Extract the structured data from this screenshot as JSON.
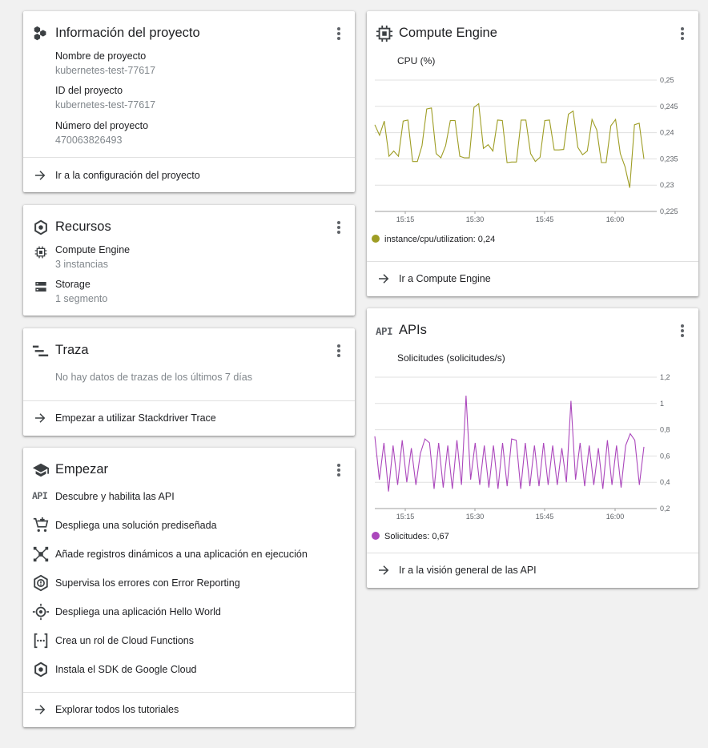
{
  "project": {
    "title": "Información del proyecto",
    "name_label": "Nombre de proyecto",
    "name_value": "kubernetes-test-77617",
    "id_label": "ID del proyecto",
    "id_value": "kubernetes-test-77617",
    "number_label": "Número del proyecto",
    "number_value": "470063826493",
    "link": "Ir a la configuración del proyecto"
  },
  "resources": {
    "title": "Recursos",
    "items": [
      {
        "label": "Compute Engine",
        "sub": "3 instancias",
        "icon": "chip-icon"
      },
      {
        "label": "Storage",
        "sub": "1 segmento",
        "icon": "storage-icon"
      }
    ]
  },
  "trace": {
    "title": "Traza",
    "empty": "No hay datos de trazas de los últimos 7 días",
    "link": "Empezar a utilizar Stackdriver Trace"
  },
  "getting_started": {
    "title": "Empezar",
    "api_glyph": "API",
    "items": [
      {
        "label": "Descubre y habilita las API",
        "icon": "api-icon"
      },
      {
        "label": "Despliega una solución prediseñada",
        "icon": "cart-icon"
      },
      {
        "label": "Añade registros dinámicos a una aplicación en ejecución",
        "icon": "debug-icon"
      },
      {
        "label": "Supervisa los errores con Error Reporting",
        "icon": "error-reporting-icon"
      },
      {
        "label": "Despliega una aplicación Hello World",
        "icon": "target-icon"
      },
      {
        "label": "Crea un rol de Cloud Functions",
        "icon": "functions-icon"
      },
      {
        "label": "Instala el SDK de Google Cloud",
        "icon": "sdk-icon"
      }
    ],
    "link": "Explorar todos los tutoriales"
  },
  "compute": {
    "title": "Compute Engine",
    "chart_title": "CPU (%)",
    "legend_label": "instance/cpu/utilization:",
    "legend_value": "0,24",
    "link": "Ir a Compute Engine",
    "color": "#9e9d24"
  },
  "apis": {
    "title": "APIs",
    "glyph": "API",
    "chart_title": "Solicitudes (solicitudes/s)",
    "legend_label": "Solicitudes:",
    "legend_value": "0,67",
    "link": "Ir a la visión general de las API",
    "color": "#ab47bc"
  },
  "chart_data": [
    {
      "type": "line",
      "title": "CPU (%)",
      "x_ticks": [
        "15:15",
        "15:30",
        "15:45",
        "16:00"
      ],
      "y_ticks": [
        "0,225",
        "0,23",
        "0,235",
        "0,24",
        "0,245",
        "0,25"
      ],
      "ylim": [
        0.225,
        0.25
      ],
      "grid": true,
      "series": [
        {
          "name": "instance/cpu/utilization",
          "color": "#9e9d24",
          "values": [
            0.2415,
            0.2395,
            0.2422,
            0.2355,
            0.2365,
            0.2355,
            0.2422,
            0.2424,
            0.2345,
            0.2345,
            0.2375,
            0.2445,
            0.2447,
            0.236,
            0.2352,
            0.2375,
            0.2423,
            0.2423,
            0.2355,
            0.2352,
            0.2352,
            0.2448,
            0.2455,
            0.237,
            0.2377,
            0.2365,
            0.2424,
            0.2423,
            0.2343,
            0.2344,
            0.2344,
            0.2424,
            0.2424,
            0.236,
            0.2345,
            0.2353,
            0.2423,
            0.2424,
            0.2367,
            0.2367,
            0.2368,
            0.2435,
            0.2441,
            0.2372,
            0.2358,
            0.2365,
            0.2425,
            0.2405,
            0.2343,
            0.2343,
            0.2413,
            0.2425,
            0.236,
            0.2335,
            0.2295,
            0.2415,
            0.2418,
            0.235
          ]
        }
      ]
    },
    {
      "type": "line",
      "title": "Solicitudes (solicitudes/s)",
      "x_ticks": [
        "15:15",
        "15:30",
        "15:45",
        "16:00"
      ],
      "y_ticks": [
        "0,2",
        "0,4",
        "0,6",
        "0,8",
        "1",
        "1,2"
      ],
      "ylim": [
        0.2,
        1.2
      ],
      "grid": true,
      "series": [
        {
          "name": "Solicitudes",
          "color": "#ab47bc",
          "values": [
            0.75,
            0.42,
            0.7,
            0.33,
            0.68,
            0.38,
            0.72,
            0.4,
            0.66,
            0.38,
            0.62,
            0.73,
            0.7,
            0.35,
            0.7,
            0.36,
            0.68,
            0.35,
            0.72,
            0.38,
            1.06,
            0.42,
            0.7,
            0.38,
            0.68,
            0.36,
            0.68,
            0.35,
            0.7,
            0.37,
            0.73,
            0.72,
            0.35,
            0.7,
            0.37,
            0.68,
            0.37,
            0.7,
            0.38,
            0.68,
            0.38,
            0.66,
            0.4,
            1.02,
            0.42,
            0.7,
            0.37,
            0.68,
            0.38,
            0.66,
            0.35,
            0.72,
            0.38,
            0.68,
            0.36,
            0.68,
            0.77,
            0.72,
            0.38,
            0.67
          ]
        }
      ]
    }
  ]
}
